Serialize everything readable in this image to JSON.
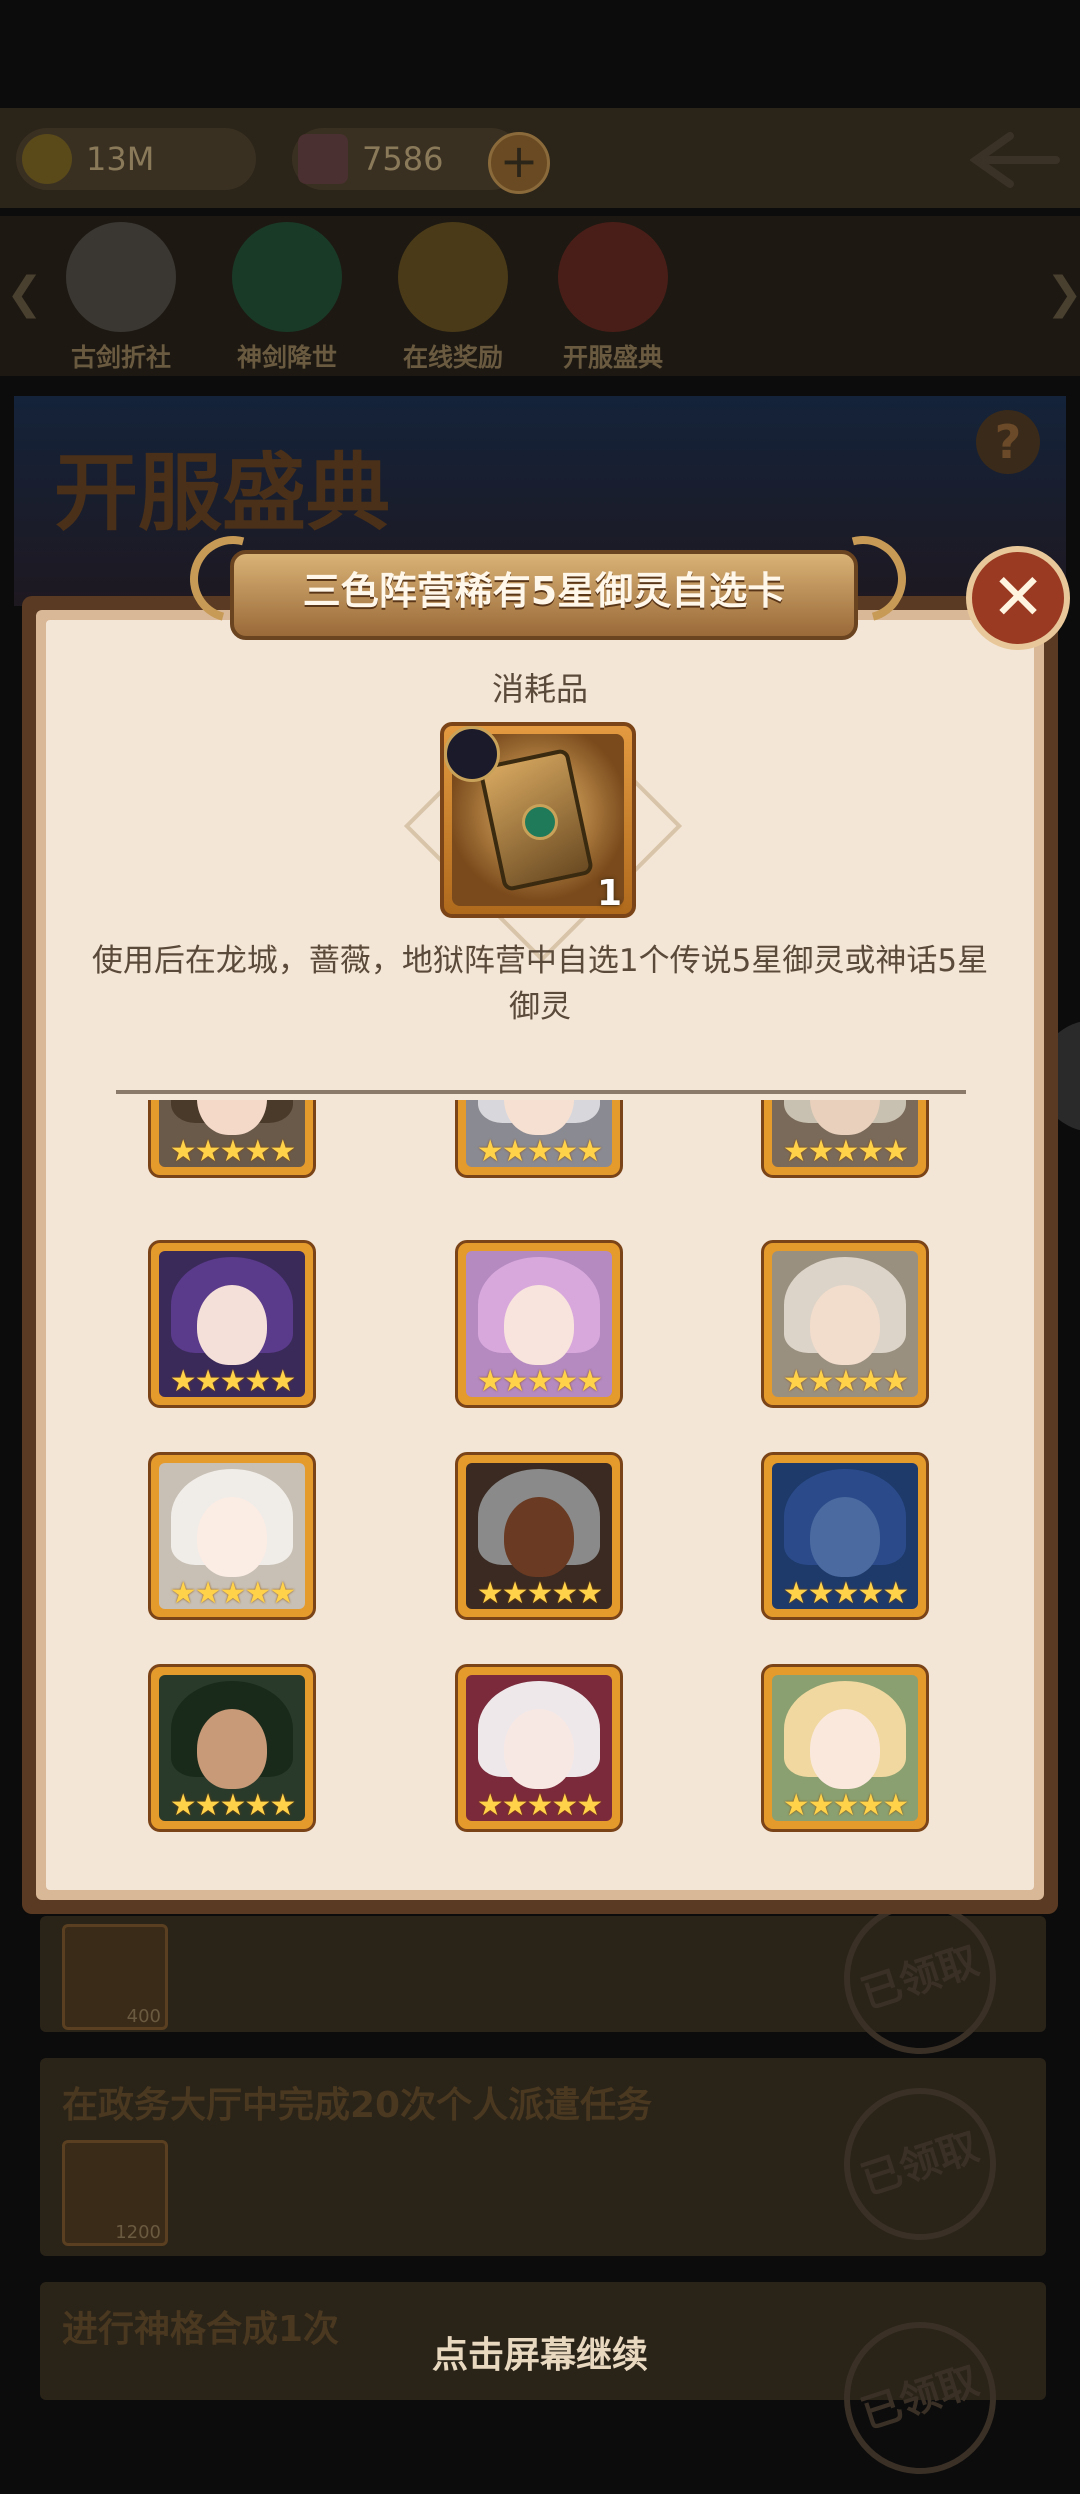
{
  "resources": {
    "gold_value": "13M",
    "gem_value": "7586",
    "add_label": "+"
  },
  "nav_tabs": [
    {
      "label": "古剑折社"
    },
    {
      "label": "神剑降世"
    },
    {
      "label": "在线奖励"
    },
    {
      "label": "开服盛典"
    }
  ],
  "banner": {
    "title": "开服盛典",
    "help_label": "?"
  },
  "tasks": [
    {
      "title": "",
      "item_count": "400",
      "stamp": "已领取"
    },
    {
      "title": "在政务大厅中完成20次个人派遣任务",
      "item_count": "1200",
      "stamp": "已领取"
    },
    {
      "title": "进行神格合成1次",
      "item_count": "",
      "stamp": "已领取"
    }
  ],
  "popup": {
    "title": "三色阵营稀有5星御灵自选卡",
    "close_label": "✕",
    "category": "消耗品",
    "item_count": "1",
    "description": "使用后在龙城，蔷薇，地狱阵营中自选1个传说5星御灵或神话5星御灵",
    "heroes": [
      {
        "name": "hero-1",
        "stars": "★★★★★"
      },
      {
        "name": "hero-2",
        "stars": "★★★★★"
      },
      {
        "name": "hero-3",
        "stars": "★★★★★"
      },
      {
        "name": "hero-4",
        "stars": "★★★★★"
      },
      {
        "name": "hero-5",
        "stars": "★★★★★"
      },
      {
        "name": "hero-6",
        "stars": "★★★★★"
      },
      {
        "name": "hero-7",
        "stars": "★★★★★"
      },
      {
        "name": "hero-8",
        "stars": "★★★★★"
      },
      {
        "name": "hero-9",
        "stars": "★★★★★"
      },
      {
        "name": "hero-10",
        "stars": "★★★★★"
      },
      {
        "name": "hero-11",
        "stars": "★★★★★"
      },
      {
        "name": "hero-12",
        "stars": "★★★★★"
      }
    ]
  },
  "continue_hint": "点击屏幕继续"
}
